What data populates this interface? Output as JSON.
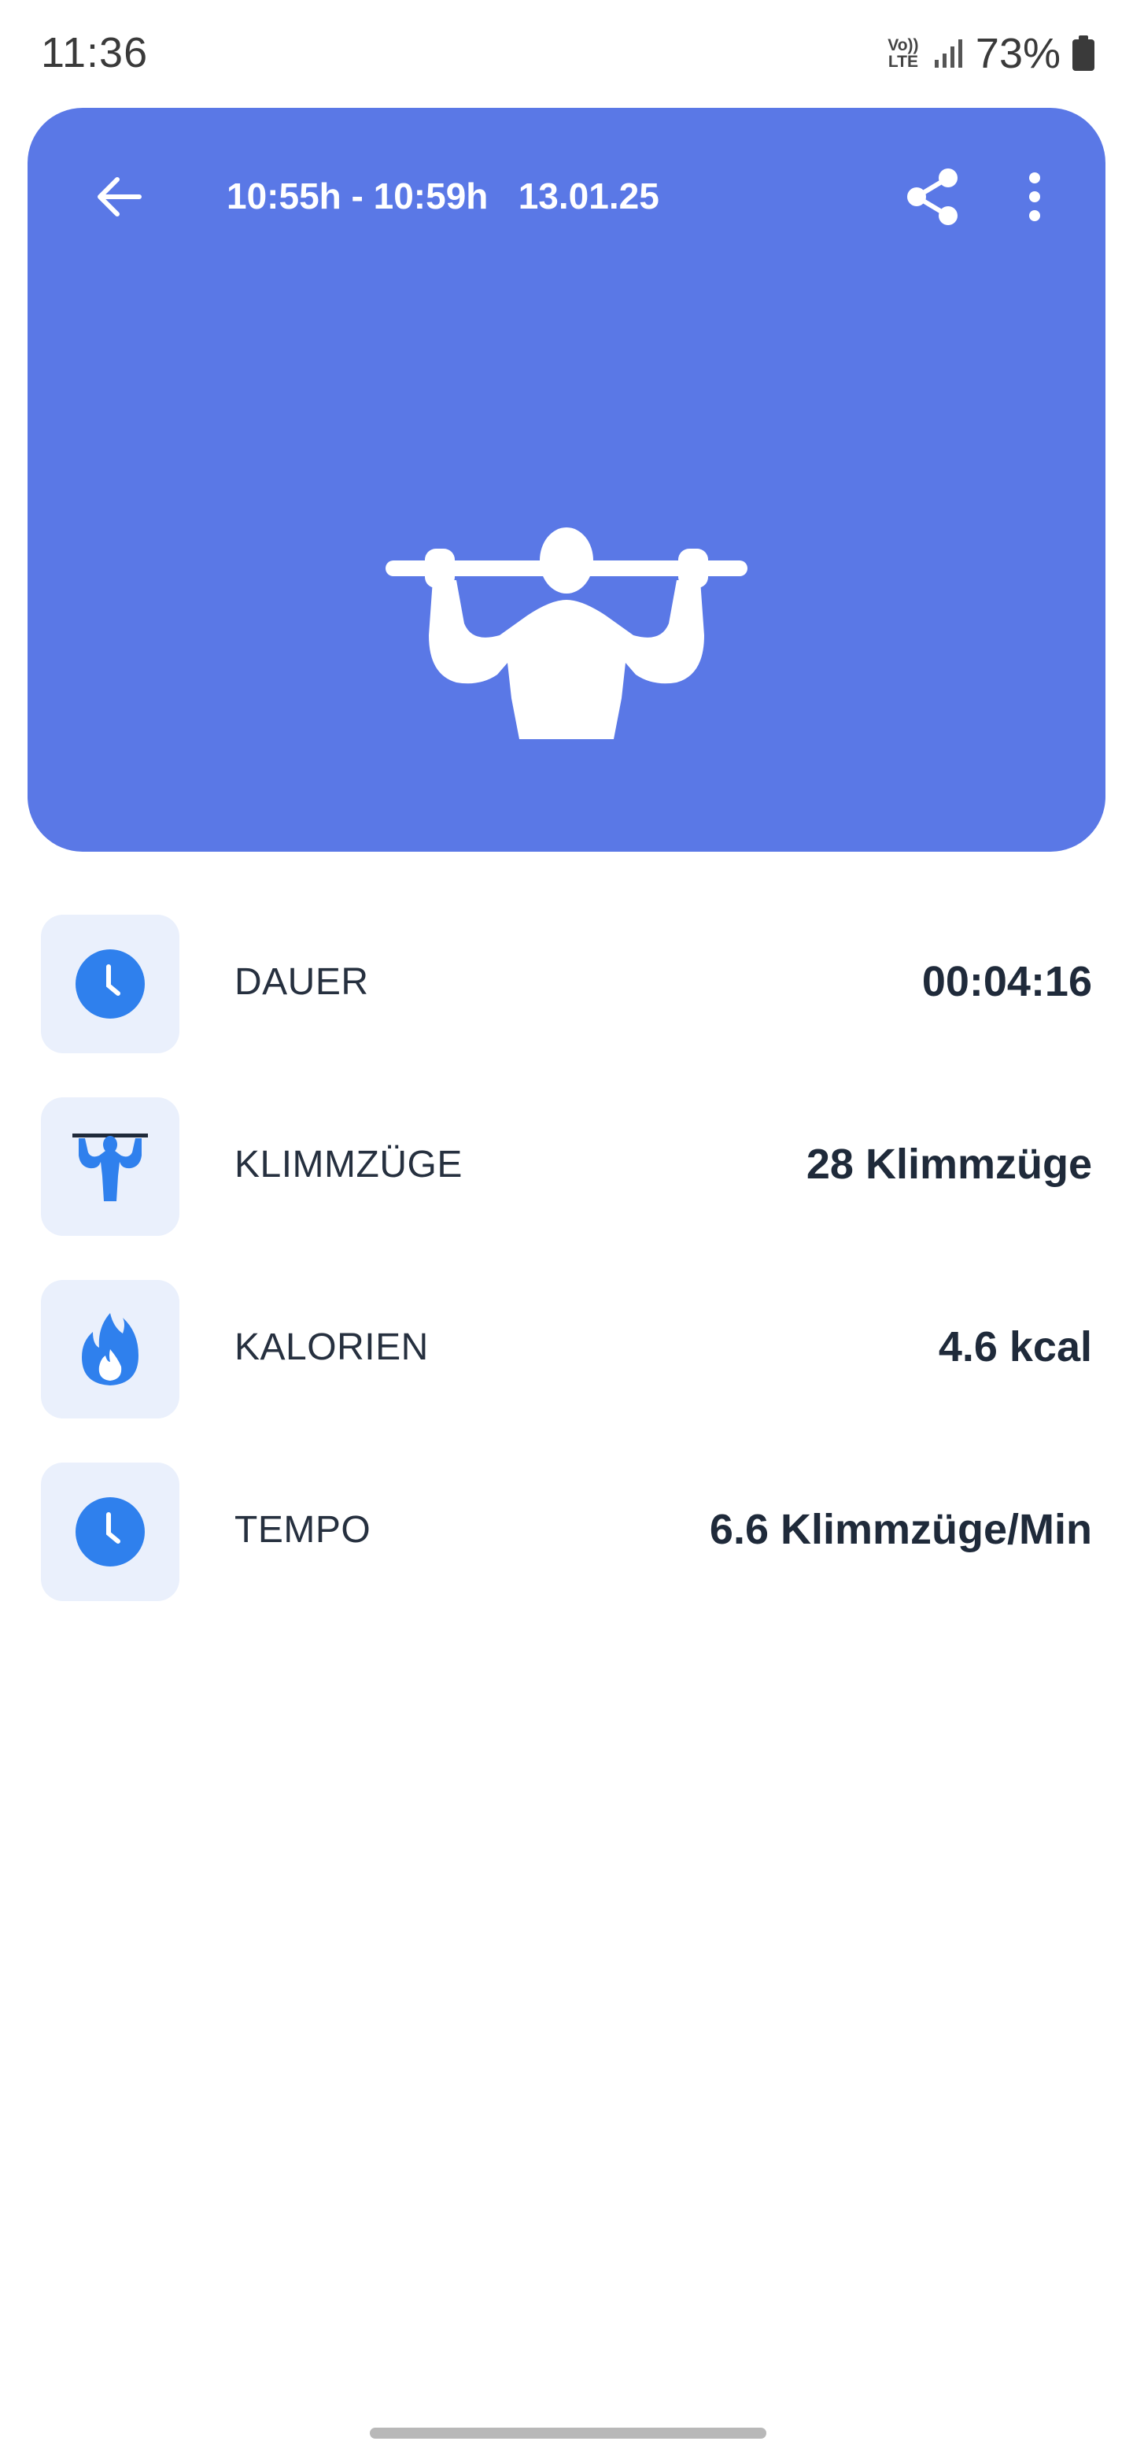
{
  "status_bar": {
    "time": "11:36",
    "volte_top": "Vo))",
    "volte_bottom": "LTE",
    "battery_percent": "73%",
    "icons": [
      "volte-icon",
      "signal-icon",
      "battery-icon"
    ]
  },
  "header": {
    "title": "10:55h - 10:59h   13.01.25",
    "background_color": "#5a78e6",
    "icons": {
      "back": "back-arrow-icon",
      "share": "share-icon",
      "more": "more-vert-icon",
      "hero": "pullup-figure-icon"
    }
  },
  "stats": [
    {
      "label": "DAUER",
      "value": "00:04:16",
      "icon": "clock-icon"
    },
    {
      "label": "KLIMMZÜGE",
      "value": "28 Klimmzüge",
      "icon": "pullup-icon"
    },
    {
      "label": "KALORIEN",
      "value": "4.6 kcal",
      "icon": "flame-icon"
    },
    {
      "label": "TEMPO",
      "value": "6.6 Klimmzüge/Min",
      "icon": "clock-icon"
    }
  ],
  "colors": {
    "accent": "#2f80ed",
    "icon_box": "#eaf0fc",
    "text_dark": "#1f2a3a"
  }
}
